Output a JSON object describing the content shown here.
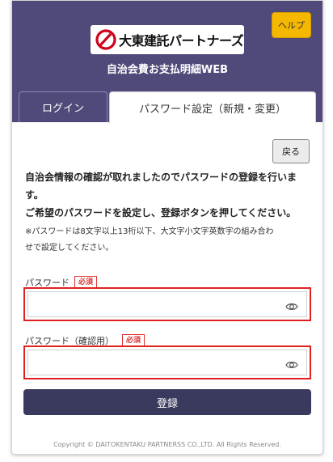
{
  "header": {
    "help_label": "ヘルプ",
    "logo_text": "大東建託パートナーズ",
    "subtitle": "自治会費お支払明細WEB"
  },
  "tabs": [
    {
      "label": "ログイン",
      "active": false
    },
    {
      "label": "パスワード設定（新規・変更）",
      "active": true
    }
  ],
  "back_label": "戻る",
  "message": {
    "line1": "自治会情報の確認が取れましたのでパスワードの登録を行いま",
    "line2": "す。",
    "line3": "ご希望のパスワードを設定し、登録ボタンを押してください。"
  },
  "note": {
    "line1": "※パスワードは8文字以上13桁以下、大文字小文字英数字の組み合わ",
    "line2": "せで設定してください。"
  },
  "fields": {
    "password_label": "パスワード",
    "password_confirm_label": "パスワード（確認用）",
    "required_badge": "必須"
  },
  "submit_label": "登録",
  "copyright": "Copyright © DAITOKENTAKU PARTNERSS CO.,LTD. All Rights Reserved.",
  "colors": {
    "header_bg": "#4f4a7a",
    "help_bg": "#f5b800",
    "submit_bg": "#3a3a5e",
    "required": "#dd3333",
    "highlight": "#e02020"
  },
  "icons": {
    "eye": "eye-icon",
    "logo_mark": "logo-mark-icon"
  }
}
